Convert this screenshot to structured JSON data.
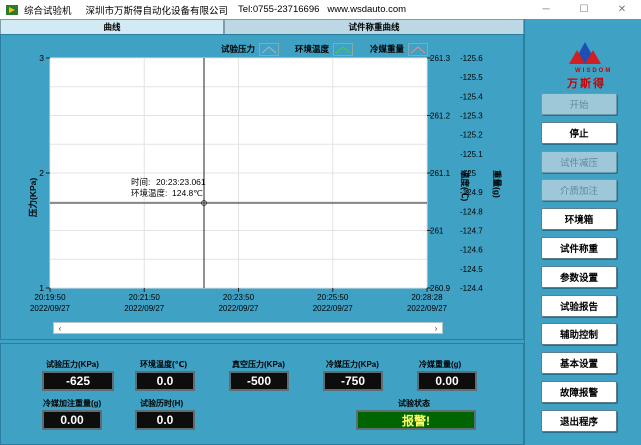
{
  "window": {
    "app_title": "综合试验机",
    "company": "深圳市万斯得自动化设备有限公司",
    "tel": "Tel:0755-23716696",
    "website": "www.wsdauto.com",
    "min_label": "─",
    "max_label": "☐",
    "close_label": "✕"
  },
  "tabs": [
    {
      "label": "曲线",
      "active": true
    },
    {
      "label": "试件称重曲线",
      "active": false
    }
  ],
  "legend": [
    {
      "label": "试验压力",
      "color": "#9ab0c8"
    },
    {
      "label": "环境温度",
      "color": "#44cc44"
    },
    {
      "label": "冷媒重量",
      "color": "#e08a8a"
    }
  ],
  "cursor": {
    "time_label": "时间:",
    "time_value": "20:23:23.061",
    "temp_label": "环境温度:",
    "temp_value": "124.8℃"
  },
  "chart_data": {
    "type": "line",
    "y1_label": "压力(KPa)",
    "y1_ticks": [
      "3",
      "2",
      "1"
    ],
    "y2_label": "温度(℃)",
    "y2_ticks": [
      "261.3",
      "261.2",
      "261.1",
      "261",
      "260.9"
    ],
    "y3_label": "重量(g)",
    "y3_ticks": [
      "-125.6",
      "-125.5",
      "-125.4",
      "-125.3",
      "-125.2",
      "-125.1",
      "-125",
      "-124.9",
      "-124.8",
      "-124.7",
      "-124.6",
      "-124.5",
      "-124.4"
    ],
    "x_ticks": [
      {
        "time": "20:19:50",
        "date": "2022/09/27"
      },
      {
        "time": "20:21:50",
        "date": "2022/09/27"
      },
      {
        "time": "20:23:50",
        "date": "2022/09/27"
      },
      {
        "time": "20:25:50",
        "date": "2022/09/27"
      },
      {
        "time": "20:28:28",
        "date": "2022/09/27"
      }
    ],
    "series": []
  },
  "scrollbar": {
    "left_arrow": "‹",
    "right_arrow": "›"
  },
  "indicators": {
    "test_pressure": {
      "label": "试验压力(KPa)",
      "value": "-625"
    },
    "ambient_temp": {
      "label": "环境温度(℃)",
      "value": "0.0"
    },
    "vacuum_pressure": {
      "label": "真空压力(KPa)",
      "value": "-500"
    },
    "refrigerant_pressure": {
      "label": "冷媒压力(KPa)",
      "value": "-750"
    },
    "refrigerant_weight": {
      "label": "冷媒重量(g)",
      "value": "0.00"
    },
    "refrigerant_fill_weight": {
      "label": "冷媒加注重量(g)",
      "value": "0.00"
    },
    "test_duration": {
      "label": "试验历时(H)",
      "value": "0.0"
    },
    "test_status": {
      "label": "试验状态",
      "value": "报警!"
    }
  },
  "logo": {
    "latin": "WISDOM",
    "cn": "万斯得"
  },
  "buttons": [
    {
      "label": "开始",
      "enabled": false
    },
    {
      "label": "停止",
      "enabled": true
    },
    {
      "label": "试件减压",
      "enabled": false
    },
    {
      "label": "介质加注",
      "enabled": false
    },
    {
      "label": "环境箱",
      "enabled": true
    },
    {
      "label": "试件称重",
      "enabled": true
    },
    {
      "label": "参数设置",
      "enabled": true
    },
    {
      "label": "试验报告",
      "enabled": true
    },
    {
      "label": "辅助控制",
      "enabled": true
    },
    {
      "label": "基本设置",
      "enabled": true
    },
    {
      "label": "故障报警",
      "enabled": true
    },
    {
      "label": "退出程序",
      "enabled": true
    }
  ]
}
